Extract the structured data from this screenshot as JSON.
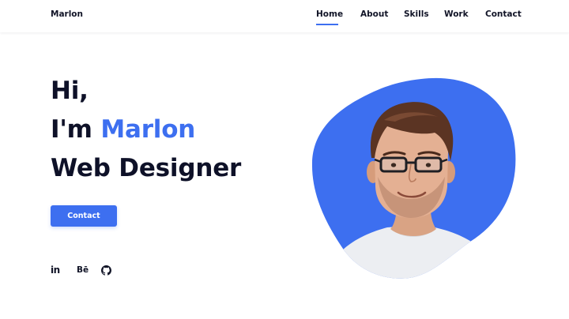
{
  "header": {
    "logo": "Marlon",
    "nav": [
      {
        "label": "Home",
        "active": true
      },
      {
        "label": "About"
      },
      {
        "label": "Skills"
      },
      {
        "label": "Work"
      },
      {
        "label": "Contact"
      }
    ]
  },
  "hero": {
    "line1": "Hi,",
    "line2_prefix": "I'm ",
    "line2_name": "Marlon",
    "line3": "Web Designer",
    "button_label": "Contact"
  },
  "socials": {
    "linkedin": "in",
    "behance": "Bē",
    "github_icon": "github-icon"
  },
  "colors": {
    "accent": "#3d6ff0",
    "text": "#0e1128",
    "background": "#ffffff"
  }
}
